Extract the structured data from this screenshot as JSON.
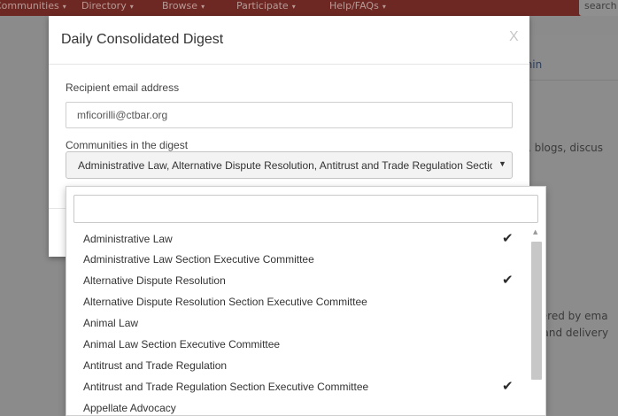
{
  "navbar": {
    "items": [
      {
        "label": "Communities"
      },
      {
        "label": "Directory"
      },
      {
        "label": "Browse"
      },
      {
        "label": "Participate"
      },
      {
        "label": "Help/FAQs"
      }
    ],
    "search_placeholder": "search"
  },
  "background": {
    "admin_link": "Admin",
    "text_line1": "ents, blogs, discus",
    "text_line2": "delivered by ema",
    "text_line3": "ency and delivery"
  },
  "modal": {
    "title": "Daily Consolidated Digest",
    "close_label": "X",
    "email_label": "Recipient email address",
    "email_value": "mficorilli@ctbar.org",
    "communities_label": "Communities in the digest",
    "selected_communities": "Administrative Law, Alternative Dispute Resolution, Antitrust and Trade Regulation Section Executive Committee"
  },
  "dropdown": {
    "search_value": "",
    "options": [
      {
        "label": "Administrative Law",
        "checked": true
      },
      {
        "label": "Administrative Law Section Executive Committee",
        "checked": false
      },
      {
        "label": "Alternative Dispute Resolution",
        "checked": true
      },
      {
        "label": "Alternative Dispute Resolution Section Executive Committee",
        "checked": false
      },
      {
        "label": "Animal Law",
        "checked": false
      },
      {
        "label": "Animal Law Section Executive Committee",
        "checked": false
      },
      {
        "label": "Antitrust and Trade Regulation",
        "checked": false
      },
      {
        "label": "Antitrust and Trade Regulation Section Executive Committee",
        "checked": true
      },
      {
        "label": "Appellate Advocacy",
        "checked": false
      }
    ],
    "check_glyph": "✔"
  },
  "colors": {
    "navbar": "#6e2823",
    "overlay": "#8b8b8b",
    "accent_button": "#b73a2c"
  }
}
